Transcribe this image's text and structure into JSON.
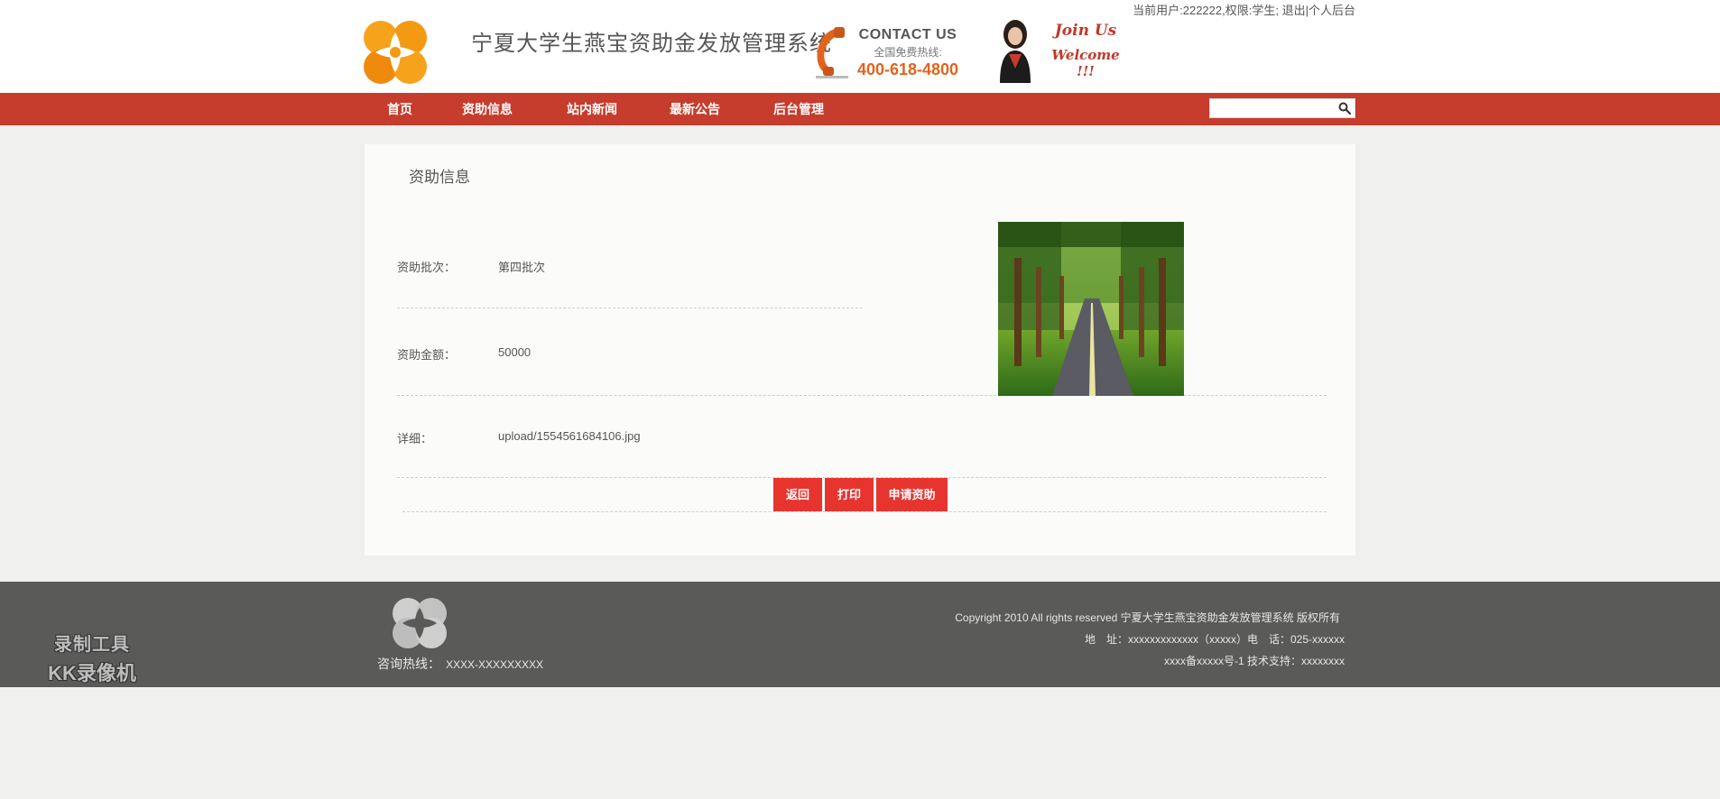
{
  "header": {
    "user_info": "当前用户:222222,权限:学生;",
    "logout_link": "退出",
    "backend_link": "个人后台",
    "site_title": "宁夏大学生燕宝资助金发放管理系统",
    "contact_title": "CONTACT US",
    "contact_subtitle": "全国免费热线:",
    "contact_phone": "400-618-4800",
    "join_line1": "Join Us",
    "join_line2": "Welcome !!!"
  },
  "nav": {
    "items": [
      {
        "label": "首页"
      },
      {
        "label": "资助信息"
      },
      {
        "label": "站内新闻"
      },
      {
        "label": "最新公告"
      },
      {
        "label": "后台管理"
      }
    ],
    "search_value": ""
  },
  "content": {
    "title": "资助信息",
    "rows": [
      {
        "label": "资助批次：",
        "value": "第四批次"
      },
      {
        "label": "资助金额：",
        "value": "50000"
      },
      {
        "label": "详细：",
        "value": "upload/1554561684106.jpg"
      }
    ],
    "buttons": {
      "back": "返回",
      "print": "打印",
      "apply": "申请资助"
    }
  },
  "footer": {
    "hotline_label": "咨询热线：",
    "hotline_value": "XXXX-XXXXXXXXX",
    "copyright": "Copyright 2010 All rights reserved 宁夏大学生燕宝资助金发放管理系统 版权所有",
    "address": "地　址：xxxxxxxxxxxxx（xxxxx）电　话：025-xxxxxx",
    "icp": "xxxx备xxxxx号-1 技术支持：xxxxxxxx"
  },
  "watermark": {
    "line1": "录制工具",
    "line2": "KK录像机"
  },
  "colors": {
    "nav_bg": "#c63c2d",
    "button_bg": "#e7342f",
    "footer_bg": "#5a5a58",
    "phone_orange": "#e0641e"
  }
}
